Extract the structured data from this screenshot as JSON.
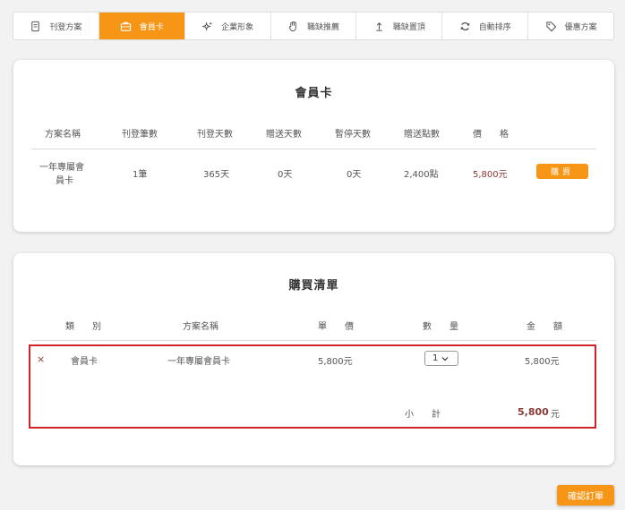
{
  "tabs": [
    {
      "label": "刊登方案",
      "icon": "document-icon"
    },
    {
      "label": "會員卡",
      "icon": "briefcase-icon"
    },
    {
      "label": "企業形象",
      "icon": "sparkle-icon"
    },
    {
      "label": "職缺推薦",
      "icon": "hand-icon"
    },
    {
      "label": "職缺置頂",
      "icon": "arrow-up-icon"
    },
    {
      "label": "自動排序",
      "icon": "refresh-icon"
    },
    {
      "label": "優惠方案",
      "icon": "tag-icon"
    }
  ],
  "active_tab": "會員卡",
  "member_card": {
    "title": "會員卡",
    "headers": [
      "方案名稱",
      "刊登筆數",
      "刊登天數",
      "贈送天數",
      "暫停天數",
      "贈送點數",
      "價　　格"
    ],
    "row": {
      "name_line1": "一年專屬會",
      "name_line2": "員卡",
      "postings": "1筆",
      "days": "365天",
      "bonus_days": "0天",
      "pause_days": "0天",
      "bonus_points": "2,400點",
      "price": "5,800元"
    },
    "buy_label": "購買"
  },
  "cart": {
    "title": "購買清單",
    "headers": [
      "類　　別",
      "方案名稱",
      "單　　價",
      "數　　量",
      "金　　額"
    ],
    "item": {
      "category": "會員卡",
      "name": "一年專屬會員卡",
      "unit_price": "5,800元",
      "quantity": "1",
      "amount": "5,800元"
    },
    "subtotal_label": "小　　計",
    "subtotal_value": "5,800",
    "subtotal_unit": "元",
    "remove_symbol": "×"
  },
  "confirm_label": "確認訂單",
  "colors": {
    "accent": "#f79616",
    "price": "#8a3a35",
    "highlight": "#d2232a"
  }
}
